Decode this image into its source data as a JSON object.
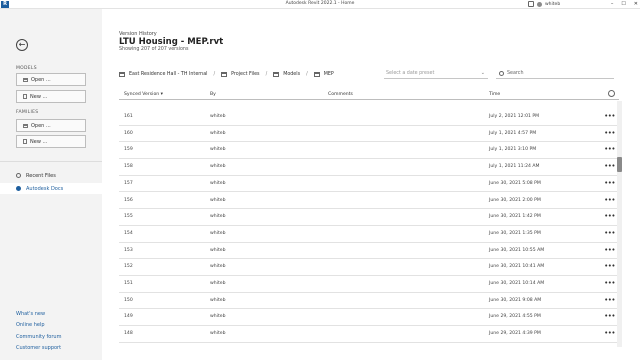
{
  "titlebar": {
    "app_icon": "R",
    "title": "Autodesk Revit 2022.1 - Home",
    "user": "whiteb",
    "minimize": "–",
    "maximize": "☐",
    "close": "✕"
  },
  "sidebar": {
    "back_icon": "←",
    "models_header": "MODELS",
    "models_open": "Open ...",
    "models_new": "New ...",
    "families_header": "FAMILIES",
    "families_open": "Open ...",
    "families_new": "New ...",
    "recent_files": "Recent Files",
    "autodesk_docs": "Autodesk Docs",
    "footer_links": [
      "What's new",
      "Online help",
      "Community forum",
      "Customer support"
    ]
  },
  "header": {
    "label": "Version History",
    "title": "LTU Housing - MEP.rvt",
    "subtitle": "Showing 207 of 207 versions"
  },
  "breadcrumb": [
    "East Residence Hall - TH Internal",
    "Project Files",
    "Models",
    "MEP"
  ],
  "filters": {
    "date_placeholder": "Select a date preset",
    "search_placeholder": "Search"
  },
  "table": {
    "columns": [
      "Synced Version",
      "By",
      "Comments",
      "Time"
    ],
    "sort_indicator": "▾",
    "more_label": "•••",
    "rows": [
      {
        "version": "161",
        "by": "whiteb",
        "comment": "",
        "time": "July 2, 2021 12:01 PM"
      },
      {
        "version": "160",
        "by": "whiteb",
        "comment": "",
        "time": "July 1, 2021 4:57 PM"
      },
      {
        "version": "159",
        "by": "whiteb",
        "comment": "",
        "time": "July 1, 2021 3:10 PM"
      },
      {
        "version": "158",
        "by": "whiteb",
        "comment": "",
        "time": "July 1, 2021 11:24 AM"
      },
      {
        "version": "157",
        "by": "whiteb",
        "comment": "",
        "time": "June 30, 2021 5:08 PM"
      },
      {
        "version": "156",
        "by": "whiteb",
        "comment": "",
        "time": "June 30, 2021 2:00 PM"
      },
      {
        "version": "155",
        "by": "whiteb",
        "comment": "",
        "time": "June 30, 2021 1:42 PM"
      },
      {
        "version": "154",
        "by": "whiteb",
        "comment": "",
        "time": "June 30, 2021 1:35 PM"
      },
      {
        "version": "153",
        "by": "whiteb",
        "comment": "",
        "time": "June 30, 2021 10:55 AM"
      },
      {
        "version": "152",
        "by": "whiteb",
        "comment": "",
        "time": "June 30, 2021 10:41 AM"
      },
      {
        "version": "151",
        "by": "whiteb",
        "comment": "",
        "time": "June 30, 2021 10:14 AM"
      },
      {
        "version": "150",
        "by": "whiteb",
        "comment": "",
        "time": "June 30, 2021 9:08 AM"
      },
      {
        "version": "149",
        "by": "whiteb",
        "comment": "",
        "time": "June 29, 2021 4:55 PM"
      },
      {
        "version": "148",
        "by": "whiteb",
        "comment": "",
        "time": "June 29, 2021 4:39 PM"
      }
    ]
  }
}
